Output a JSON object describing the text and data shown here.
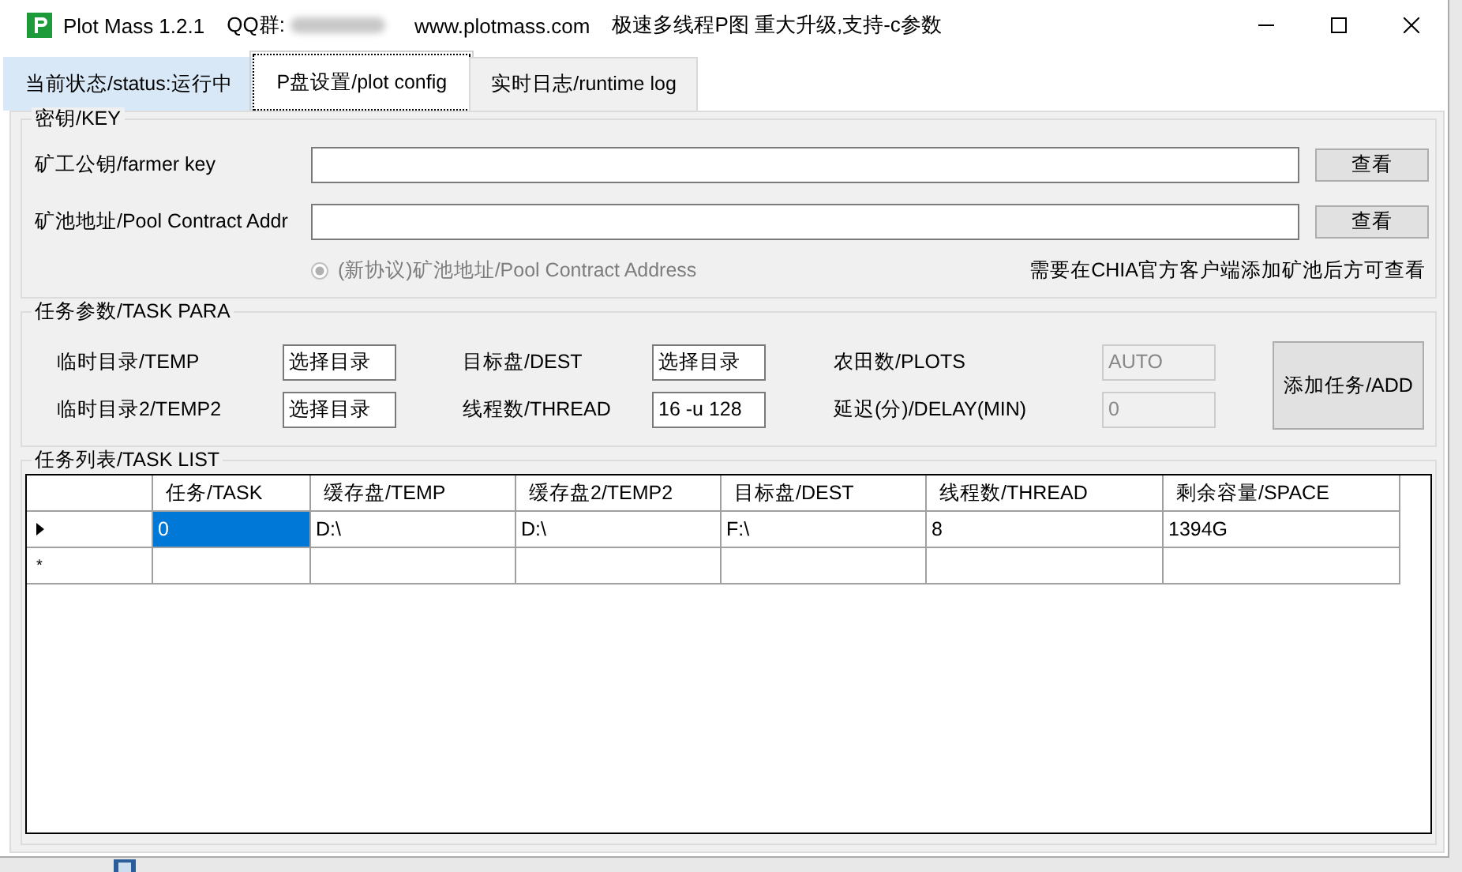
{
  "window": {
    "title": "Plot Mass 1.2.1",
    "qq_label": "QQ群:",
    "website": "www.plotmass.com",
    "slogan": "极速多线程P图 重大升级,支持-c参数"
  },
  "tabs": [
    {
      "label": "当前状态/status:运行中",
      "selected": false
    },
    {
      "label": "P盘设置/plot config",
      "selected": true
    },
    {
      "label": "实时日志/runtime log",
      "selected": false
    }
  ],
  "key_group": {
    "title": "密钥/KEY",
    "fields": [
      {
        "label": "矿工公钥/farmer key",
        "button": "查看"
      },
      {
        "label": "矿池地址/Pool Contract Addr",
        "button": "查看"
      }
    ],
    "radio": {
      "label": "(新协议)矿池地址/Pool Contract Address",
      "checked": true,
      "disabled": true
    },
    "note": "需要在CHIA官方客户端添加矿池后方可查看"
  },
  "task_para": {
    "title": "任务参数/TASK PARA",
    "fields": [
      {
        "label": "临时目录/TEMP",
        "value": "选择目录",
        "disabled": false
      },
      {
        "label": "目标盘/DEST",
        "value": "选择目录",
        "disabled": false
      },
      {
        "label": "农田数/PLOTS",
        "value": "AUTO",
        "disabled": true
      },
      {
        "label": "临时目录2/TEMP2",
        "value": "选择目录",
        "disabled": false
      },
      {
        "label": "线程数/THREAD",
        "value": "16 -u 128",
        "disabled": false
      },
      {
        "label": "延迟(分)/DELAY(MIN)",
        "value": "0",
        "disabled": true
      }
    ],
    "add_button": "添加任务/ADD"
  },
  "task_list": {
    "title": "任务列表/TASK LIST",
    "columns": [
      "任务/TASK",
      "缓存盘/TEMP",
      "缓存盘2/TEMP2",
      "目标盘/DEST",
      "线程数/THREAD",
      "剩余容量/SPACE"
    ],
    "rows": [
      {
        "kind": "current",
        "cells": [
          {
            "text": "0",
            "selected": true
          },
          {
            "text": "D:\\",
            "selected": false
          },
          {
            "text": "D:\\",
            "selected": false
          },
          {
            "text": "F:\\",
            "selected": false
          },
          {
            "text": "8",
            "selected": false
          },
          {
            "text": "1394G",
            "selected": false
          }
        ]
      },
      {
        "kind": "new",
        "marker": "*"
      }
    ]
  }
}
